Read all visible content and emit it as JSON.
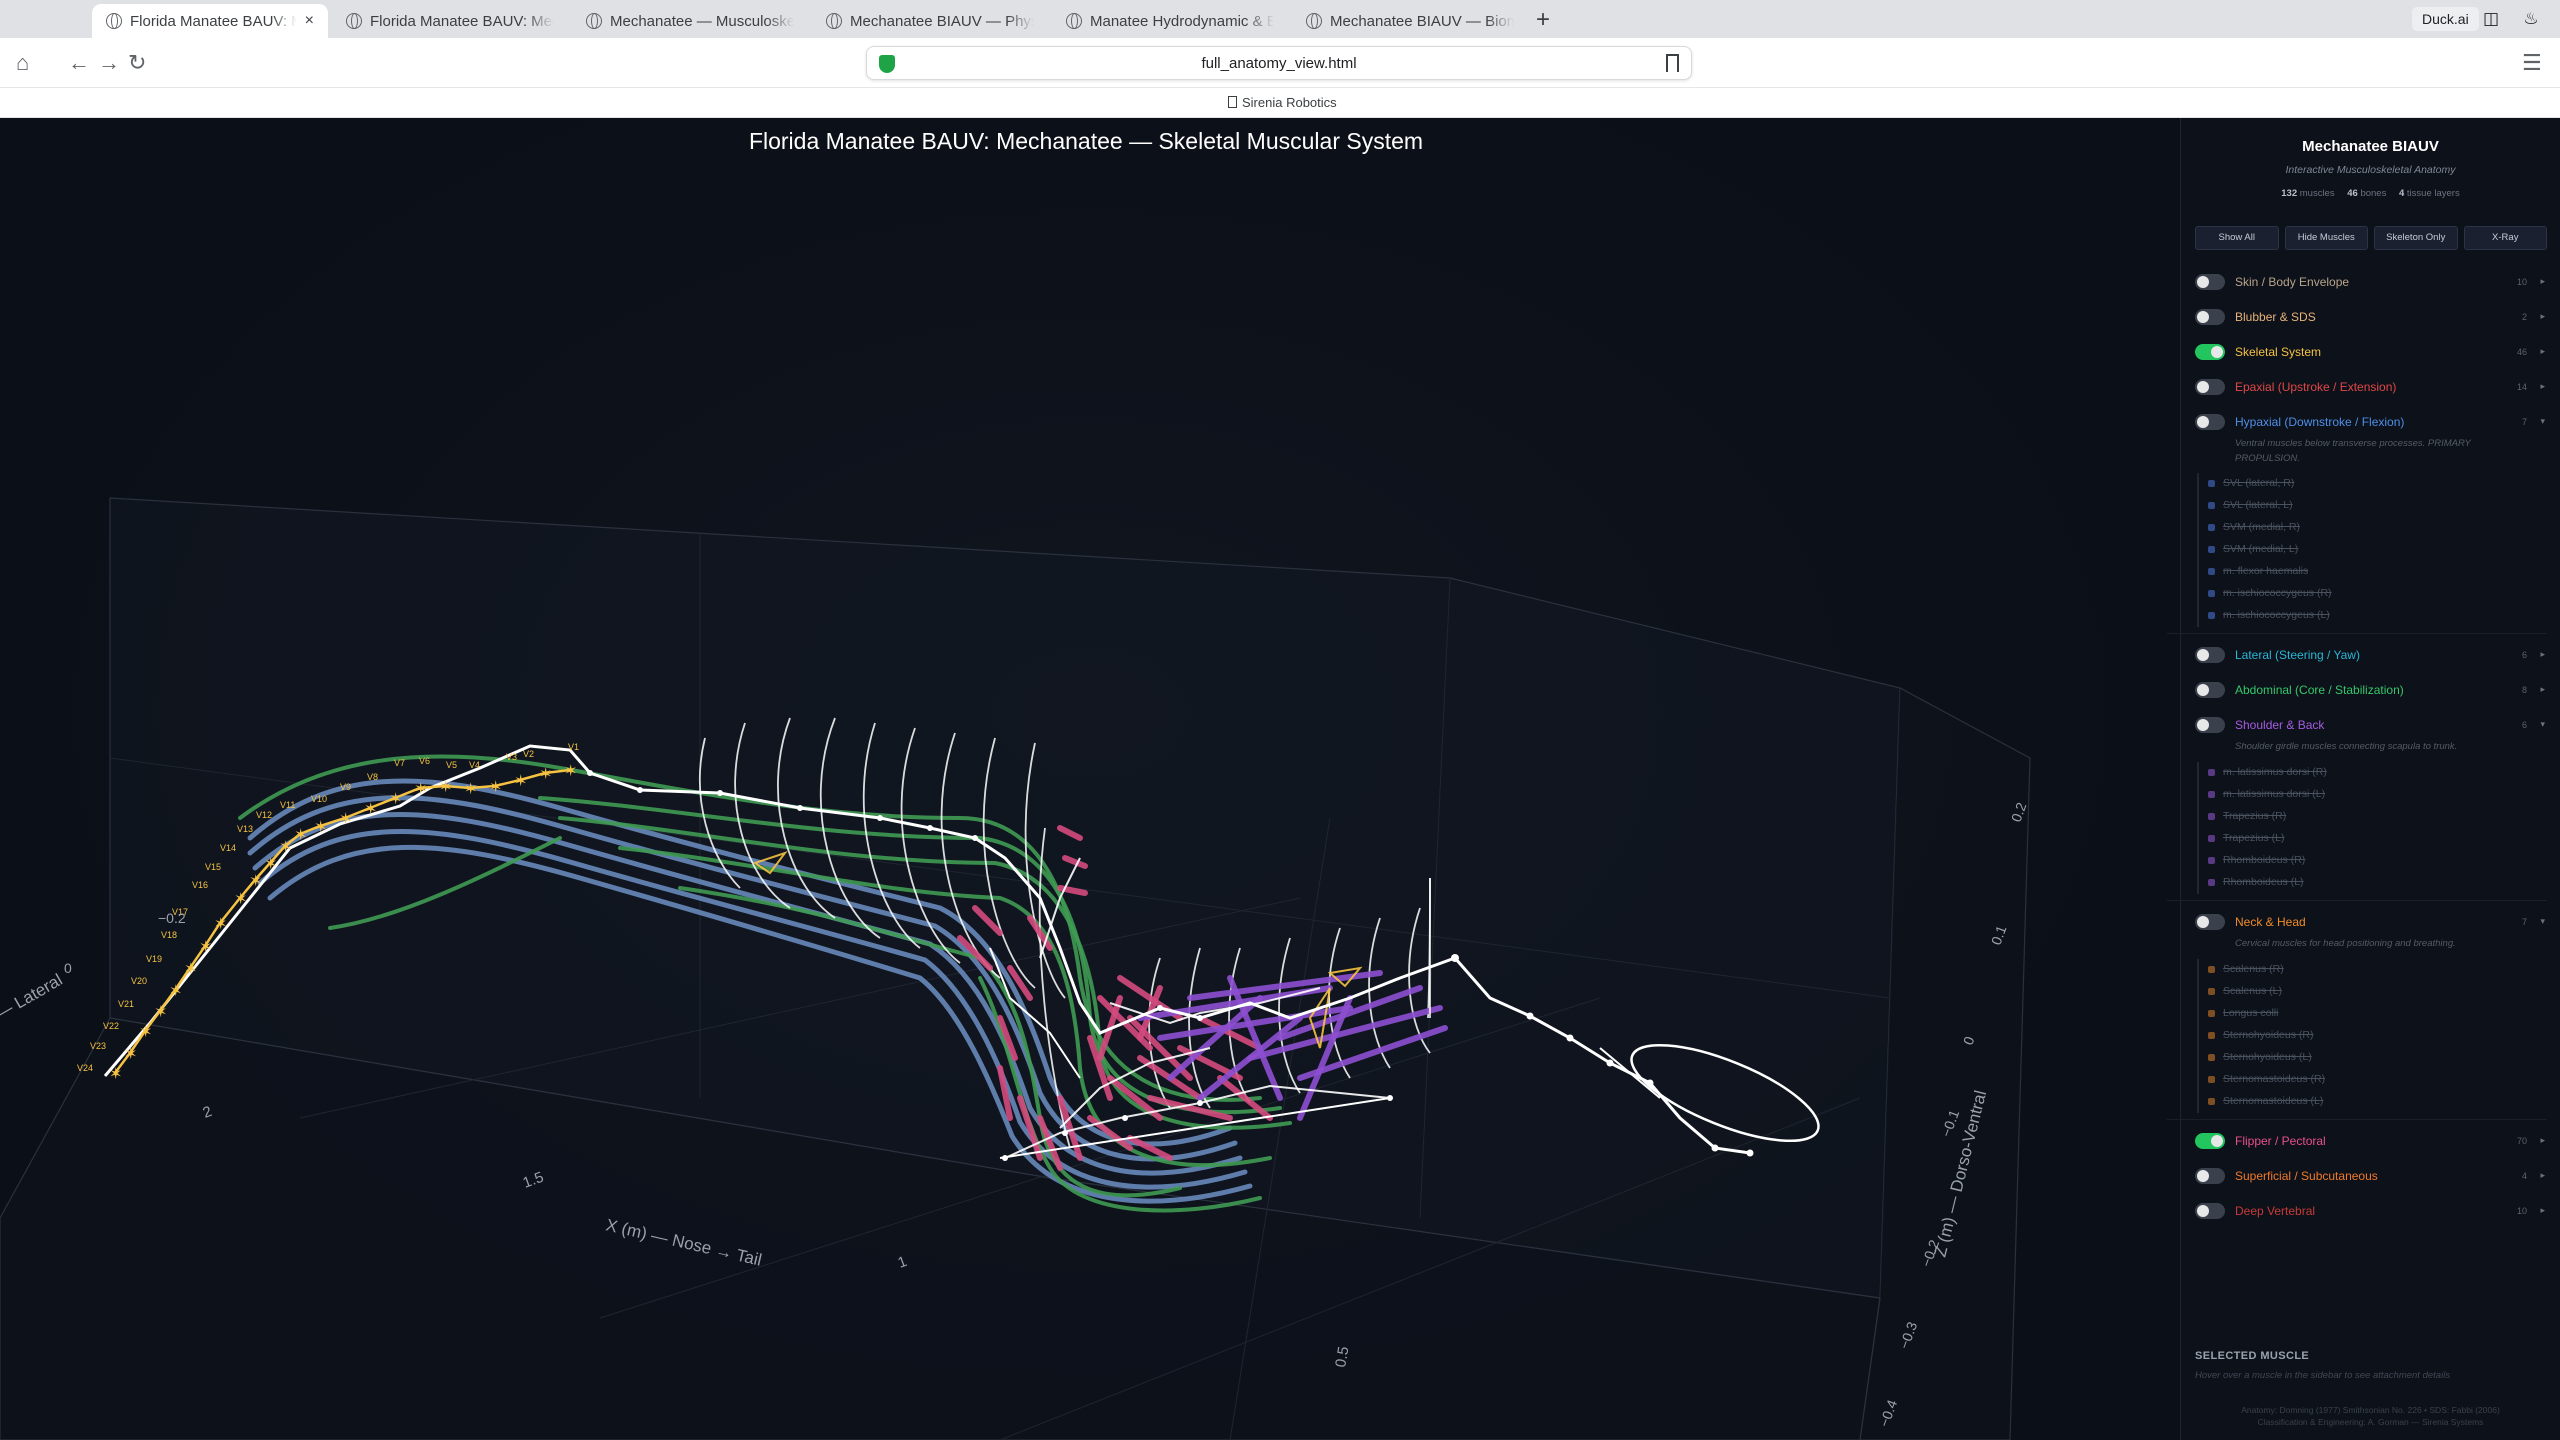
{
  "browser": {
    "tabs": [
      {
        "label": "Florida Manatee BAUV: Mechanatee",
        "active": true
      },
      {
        "label": "Florida Manatee BAUV: Mechanatee",
        "active": false
      },
      {
        "label": "Mechanatee — Musculoskeletal",
        "active": false
      },
      {
        "label": "Mechanatee BIAUV — Physics &",
        "active": false
      },
      {
        "label": "Manatee Hydrodynamic & Biom",
        "active": false
      },
      {
        "label": "Mechanatee BIAUV — Biomimet",
        "active": false
      }
    ],
    "new_tab": "+",
    "tab_close": "×",
    "duck_label": "Duck.ai",
    "url": "full_anatomy_view.html",
    "bookmark": "Sirenia Robotics"
  },
  "plot": {
    "title": "Florida Manatee BAUV: Mechanatee — Skeletal Muscular System",
    "axes": {
      "x_label": "X (m) — Nose → Tail",
      "y_label": "Y (m) — Lateral",
      "z_label": "Z (m) — Dorso-Ventral",
      "x_ticks": [
        "2",
        "1.5",
        "1",
        "0.5"
      ],
      "y_ticks": [
        "0",
        "−0.2"
      ],
      "z_ticks": [
        "0.2",
        "0.1",
        "0",
        "−0.1",
        "−0.2",
        "−0.3",
        "−0.4"
      ]
    },
    "vertebra_labels": [
      "V1",
      "V2",
      "V3",
      "V4",
      "V5",
      "V6",
      "V7",
      "V8",
      "V9",
      "V10",
      "V11",
      "V12",
      "V13",
      "V14",
      "V15",
      "V16",
      "V17",
      "V18",
      "V19",
      "V20",
      "V21",
      "V22",
      "V23",
      "V24"
    ],
    "colors": {
      "spine": "#f5c242",
      "epaxial": "#3f9a52",
      "hypaxial": "#6d8fc4",
      "flipper": "#d44a7e",
      "shoulder": "#8d4fd0",
      "skeleton": "#ffffff"
    }
  },
  "sidebar": {
    "title": "Mechanatee BIAUV",
    "subtitle": "Interactive Musculoskeletal Anatomy",
    "stats": [
      {
        "num": "132",
        "label": "muscles"
      },
      {
        "num": "46",
        "label": "bones"
      },
      {
        "num": "4",
        "label": "tissue layers"
      }
    ],
    "buttons": [
      "Show All",
      "Hide Muscles",
      "Skeleton Only",
      "X-Ray"
    ],
    "layers": [
      {
        "name": "Skin / Body Envelope",
        "color": "#b9a48c",
        "count": "10",
        "on": false,
        "caret": "▸"
      },
      {
        "name": "Blubber & SDS",
        "color": "#e8b27a",
        "count": "2",
        "on": false,
        "caret": "▸"
      },
      {
        "name": "Skeletal System",
        "color": "#f5c242",
        "count": "46",
        "on": true,
        "caret": "▸"
      },
      {
        "name": "Epaxial (Upstroke / Extension)",
        "color": "#e04848",
        "count": "14",
        "on": false,
        "caret": "▸"
      },
      {
        "name": "Hypaxial (Downstroke / Flexion)",
        "color": "#4f8fe8",
        "count": "7",
        "on": false,
        "caret": "▾",
        "desc": "Ventral muscles below transverse processes. PRIMARY PROPULSION.",
        "items": [
          "SVL (lateral, R)",
          "SVL (lateral, L)",
          "SVM (medial, R)",
          "SVM (medial, L)",
          "m. flexor haemalis",
          "m. ischiococcygeus (R)",
          "m. ischiococcygeus (L)"
        ],
        "dot": "#3f63b5"
      },
      {
        "name": "Lateral (Steering / Yaw)",
        "color": "#2ab6d6",
        "count": "6",
        "on": false,
        "caret": "▸"
      },
      {
        "name": "Abdominal (Core / Stabilization)",
        "color": "#35c76b",
        "count": "8",
        "on": false,
        "caret": "▸"
      },
      {
        "name": "Shoulder & Back",
        "color": "#a45ce0",
        "count": "6",
        "on": false,
        "caret": "▾",
        "desc": "Shoulder girdle muscles connecting scapula to trunk.",
        "items": [
          "m. latissimus dorsi (R)",
          "m. latissimus dorsi (L)",
          "Trapezius (R)",
          "Trapezius (L)",
          "Rhomboideus (R)",
          "Rhomboideus (L)"
        ],
        "dot": "#7a4ab0"
      },
      {
        "name": "Neck & Head",
        "color": "#f08a2a",
        "count": "7",
        "on": false,
        "caret": "▾",
        "desc": "Cervical muscles for head positioning and breathing.",
        "items": [
          "Scalenus (R)",
          "Scalenus (L)",
          "Longus colli",
          "Sternohyoideus (R)",
          "Sternohyoideus (L)",
          "Sternomastoideus (R)",
          "Sternomastoideus (L)"
        ],
        "dot": "#b06a2a"
      },
      {
        "name": "Flipper / Pectoral",
        "color": "#e8508a",
        "count": "70",
        "on": true,
        "caret": "▸"
      },
      {
        "name": "Superficial / Subcutaneous",
        "color": "#f07a2a",
        "count": "4",
        "on": false,
        "caret": "▸"
      },
      {
        "name": "Deep Vertebral",
        "color": "#c83a3a",
        "count": "10",
        "on": false,
        "caret": "▸"
      }
    ],
    "selected_label": "SELECTED MUSCLE",
    "selected_hint": "Hover over a muscle in the sidebar to see attachment details",
    "footer_line1": "Anatomy: Domning (1977) Smithsonian No. 226 • SDS: Fabbi (2006)",
    "footer_line2": "Classification & Engineering: A. Gorman — Sirenia Systems"
  }
}
